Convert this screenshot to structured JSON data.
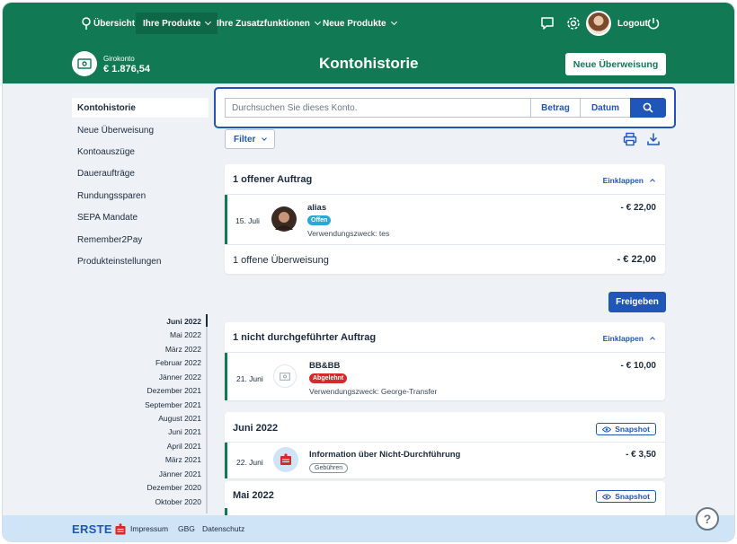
{
  "nav": {
    "overview": "Übersicht",
    "products": "Ihre Produkte",
    "extras": "Ihre Zusatzfunktionen",
    "new_products": "Neue Produkte",
    "logout": "Logout"
  },
  "account": {
    "name": "Girokonto",
    "balance": "€ 1.876,54"
  },
  "page_title": "Kontohistorie",
  "new_transfer_button": "Neue Überweisung",
  "sidebar": {
    "items": [
      {
        "label": "Kontohistorie"
      },
      {
        "label": "Neue Überweisung"
      },
      {
        "label": "Kontoauszüge"
      },
      {
        "label": "Daueraufträge"
      },
      {
        "label": "Rundungssparen"
      },
      {
        "label": "SEPA Mandate"
      },
      {
        "label": "Remember2Pay"
      },
      {
        "label": "Produkteinstellungen"
      }
    ]
  },
  "timeline": [
    "Juni 2022",
    "Mai 2022",
    "März 2022",
    "Februar 2022",
    "Jänner 2022",
    "Dezember 2021",
    "September 2021",
    "August 2021",
    "Juni 2021",
    "April 2021",
    "März 2021",
    "Jänner 2021",
    "Dezember 2020",
    "Oktober 2020"
  ],
  "search": {
    "placeholder": "Durchsuchen Sie dieses Konto.",
    "amount_label": "Betrag",
    "date_label": "Datum"
  },
  "filter_label": "Filter",
  "open_orders": {
    "title": "1 offener Auftrag",
    "collapse_label": "Einklappen",
    "transaction": {
      "date": "15. Juli",
      "name": "alias",
      "status": "Offen",
      "purpose": "Verwendungszweck: tes",
      "amount": "- € 22,00"
    },
    "summary_label": "1 offene Überweisung",
    "summary_amount": "- € 22,00"
  },
  "release_button": "Freigeben",
  "failed_orders": {
    "title": "1 nicht durchgeführter Auftrag",
    "collapse_label": "Einklappen",
    "transaction": {
      "date": "21. Juni",
      "name": "BB&BB",
      "status": "Abgelehnt",
      "purpose": "Verwendungszweck: George-Transfer",
      "amount": "- € 10,00"
    }
  },
  "month_june": {
    "title": "Juni 2022",
    "snapshot_label": "Snapshot",
    "transaction": {
      "date": "22. Juni",
      "name": "Information über Nicht-Durchführung",
      "tag": "Gebühren",
      "amount": "- € 3,50"
    }
  },
  "month_may": {
    "title": "Mai 2022",
    "snapshot_label": "Snapshot"
  },
  "footer": {
    "logo": "ERSTE",
    "links": [
      "Impressum",
      "GBG",
      "Datenschutz"
    ]
  },
  "colors": {
    "brand_green": "#117a54",
    "accent_blue": "#1f56b8",
    "status_open": "#2aa7d6",
    "status_rejected": "#d62a2a"
  }
}
